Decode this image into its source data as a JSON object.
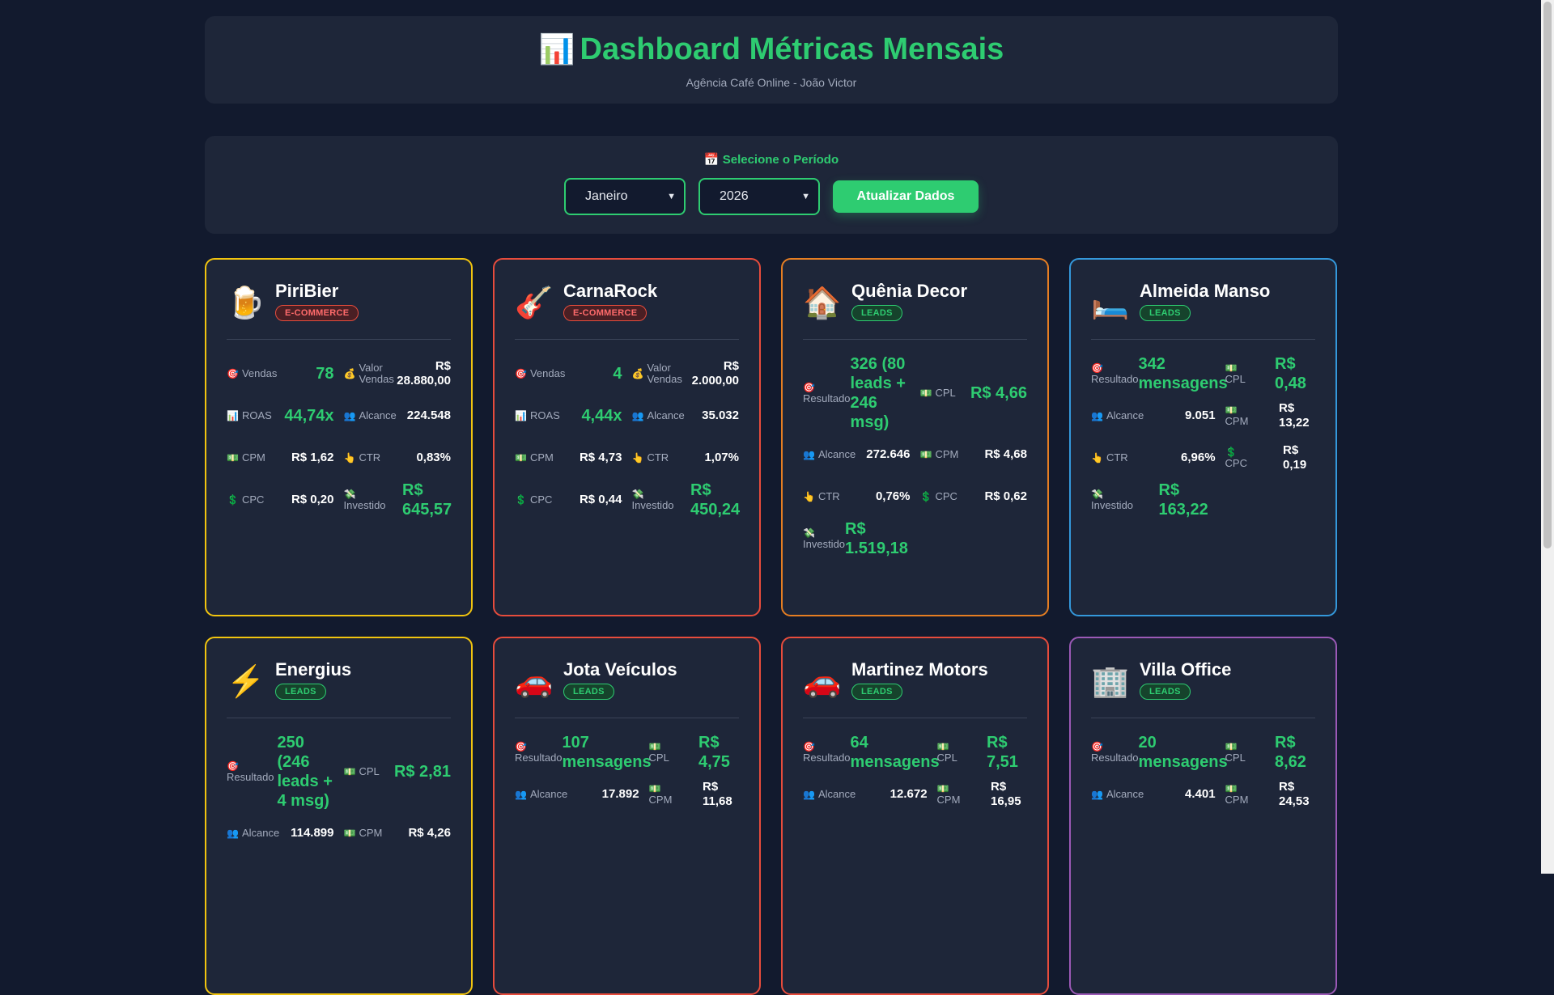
{
  "header": {
    "emoji": "📊",
    "title": "Dashboard Métricas Mensais",
    "subtitle": "Agência Café Online - João Victor"
  },
  "period": {
    "title": "📅 Selecione o Período",
    "month": "Janeiro",
    "year": "2026",
    "update_label": "Atualizar Dados"
  },
  "clients": [
    {
      "icon": "🍺",
      "name": "PiriBier",
      "badge": "E-COMMERCE",
      "metrics": [
        {
          "icon": "🎯",
          "label": "Vendas",
          "value": "78"
        },
        {
          "icon": "💰",
          "label": "Valor Vendas",
          "value": "R$ 28.880,00"
        },
        {
          "icon": "📊",
          "label": "ROAS",
          "value": "44,74x"
        },
        {
          "icon": "👥",
          "label": "Alcance",
          "value": "224.548"
        },
        {
          "icon": "💵",
          "label": "CPM",
          "value": "R$ 1,62"
        },
        {
          "icon": "👆",
          "label": "CTR",
          "value": "0,83%"
        },
        {
          "icon": "💲",
          "label": "CPC",
          "value": "R$ 0,20"
        },
        {
          "icon": "💸",
          "label": "Investido",
          "value": "R$ 645,57"
        }
      ]
    },
    {
      "icon": "🎸",
      "name": "CarnaRock",
      "badge": "E-COMMERCE",
      "metrics": [
        {
          "icon": "🎯",
          "label": "Vendas",
          "value": "4"
        },
        {
          "icon": "💰",
          "label": "Valor Vendas",
          "value": "R$ 2.000,00"
        },
        {
          "icon": "📊",
          "label": "ROAS",
          "value": "4,44x"
        },
        {
          "icon": "👥",
          "label": "Alcance",
          "value": "35.032"
        },
        {
          "icon": "💵",
          "label": "CPM",
          "value": "R$ 4,73"
        },
        {
          "icon": "👆",
          "label": "CTR",
          "value": "1,07%"
        },
        {
          "icon": "💲",
          "label": "CPC",
          "value": "R$ 0,44"
        },
        {
          "icon": "💸",
          "label": "Investido",
          "value": "R$ 450,24"
        }
      ]
    },
    {
      "icon": "🏠",
      "name": "Quênia Decor",
      "badge": "LEADS",
      "metrics": [
        {
          "icon": "🎯",
          "label": "Resultado",
          "value": "326 (80 leads + 246 msg)"
        },
        {
          "icon": "💵",
          "label": "CPL",
          "value": "R$ 4,66"
        },
        {
          "icon": "👥",
          "label": "Alcance",
          "value": "272.646"
        },
        {
          "icon": "💵",
          "label": "CPM",
          "value": "R$ 4,68"
        },
        {
          "icon": "👆",
          "label": "CTR",
          "value": "0,76%"
        },
        {
          "icon": "💲",
          "label": "CPC",
          "value": "R$ 0,62"
        },
        {
          "icon": "💸",
          "label": "Investido",
          "value": "R$ 1.519,18"
        }
      ]
    },
    {
      "icon": "🛏️",
      "name": "Almeida Manso",
      "badge": "LEADS",
      "metrics": [
        {
          "icon": "🎯",
          "label": "Resultado",
          "value": "342 mensagens"
        },
        {
          "icon": "💵",
          "label": "CPL",
          "value": "R$ 0,48"
        },
        {
          "icon": "👥",
          "label": "Alcance",
          "value": "9.051"
        },
        {
          "icon": "💵",
          "label": "CPM",
          "value": "R$ 13,22"
        },
        {
          "icon": "👆",
          "label": "CTR",
          "value": "6,96%"
        },
        {
          "icon": "💲",
          "label": "CPC",
          "value": "R$ 0,19"
        },
        {
          "icon": "💸",
          "label": "Investido",
          "value": "R$ 163,22"
        }
      ]
    },
    {
      "icon": "⚡",
      "name": "Energius",
      "badge": "LEADS",
      "metrics": [
        {
          "icon": "🎯",
          "label": "Resultado",
          "value": "250 (246 leads + 4 msg)"
        },
        {
          "icon": "💵",
          "label": "CPL",
          "value": "R$ 2,81"
        },
        {
          "icon": "👥",
          "label": "Alcance",
          "value": "114.899"
        },
        {
          "icon": "💵",
          "label": "CPM",
          "value": "R$ 4,26"
        }
      ]
    },
    {
      "icon": "🚗",
      "name": "Jota Veículos",
      "badge": "LEADS",
      "metrics": [
        {
          "icon": "🎯",
          "label": "Resultado",
          "value": "107 mensagens"
        },
        {
          "icon": "💵",
          "label": "CPL",
          "value": "R$ 4,75"
        },
        {
          "icon": "👥",
          "label": "Alcance",
          "value": "17.892"
        },
        {
          "icon": "💵",
          "label": "CPM",
          "value": "R$ 11,68"
        }
      ]
    },
    {
      "icon": "🚗",
      "name": "Martinez Motors",
      "badge": "LEADS",
      "metrics": [
        {
          "icon": "🎯",
          "label": "Resultado",
          "value": "64 mensagens"
        },
        {
          "icon": "💵",
          "label": "CPL",
          "value": "R$ 7,51"
        },
        {
          "icon": "👥",
          "label": "Alcance",
          "value": "12.672"
        },
        {
          "icon": "💵",
          "label": "CPM",
          "value": "R$ 16,95"
        }
      ]
    },
    {
      "icon": "🏢",
      "name": "Villa Office",
      "badge": "LEADS",
      "metrics": [
        {
          "icon": "🎯",
          "label": "Resultado",
          "value": "20 mensagens"
        },
        {
          "icon": "💵",
          "label": "CPL",
          "value": "R$ 8,62"
        },
        {
          "icon": "👥",
          "label": "Alcance",
          "value": "4.401"
        },
        {
          "icon": "💵",
          "label": "CPM",
          "value": "R$ 24,53"
        }
      ]
    }
  ],
  "colors": {
    "accent": "#2ecc71",
    "background": "#121a2e",
    "card": "#1e2639",
    "border_yellow": "#f1c40f",
    "border_red": "#e74c3c",
    "border_orange": "#e67e22",
    "border_blue": "#3498db",
    "border_purple": "#9b59b6"
  }
}
